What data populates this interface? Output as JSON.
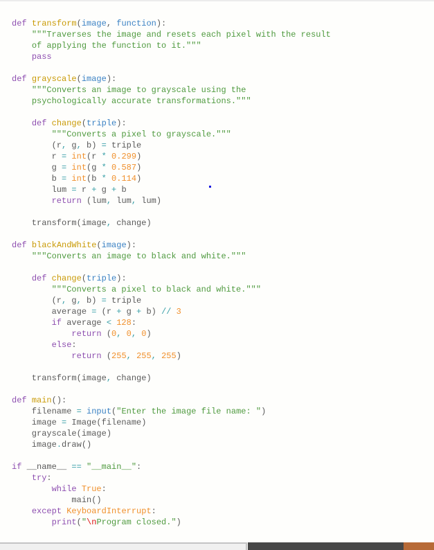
{
  "editor": {
    "language": "python",
    "lines": [
      [
        {
          "t": "def",
          "c": "kw"
        },
        {
          "t": " "
        },
        {
          "t": "transform",
          "c": "fn"
        },
        {
          "t": "("
        },
        {
          "t": "image",
          "c": "param"
        },
        {
          "t": ", "
        },
        {
          "t": "function",
          "c": "param"
        },
        {
          "t": "):"
        }
      ],
      [
        {
          "t": "    "
        },
        {
          "t": "\"\"\"Traverses the image and resets each pixel with the result",
          "c": "str"
        }
      ],
      [
        {
          "t": "    "
        },
        {
          "t": "of applying the function to it.\"\"\"",
          "c": "str"
        }
      ],
      [
        {
          "t": "    "
        },
        {
          "t": "pass",
          "c": "kw"
        }
      ],
      [],
      [
        {
          "t": "def",
          "c": "kw"
        },
        {
          "t": " "
        },
        {
          "t": "grayscale",
          "c": "fn"
        },
        {
          "t": "("
        },
        {
          "t": "image",
          "c": "param"
        },
        {
          "t": "):"
        }
      ],
      [
        {
          "t": "    "
        },
        {
          "t": "\"\"\"Converts an image to grayscale using the",
          "c": "str"
        }
      ],
      [
        {
          "t": "    "
        },
        {
          "t": "psychologically accurate transformations.\"\"\"",
          "c": "str"
        }
      ],
      [],
      [
        {
          "t": "    "
        },
        {
          "t": "def",
          "c": "kw"
        },
        {
          "t": " "
        },
        {
          "t": "change",
          "c": "fn"
        },
        {
          "t": "("
        },
        {
          "t": "triple",
          "c": "param"
        },
        {
          "t": "):"
        }
      ],
      [
        {
          "t": "        "
        },
        {
          "t": "\"\"\"Converts a pixel to grayscale.\"\"\"",
          "c": "str"
        }
      ],
      [
        {
          "t": "        (r"
        },
        {
          "t": ",",
          "c": "op"
        },
        {
          "t": " g"
        },
        {
          "t": ",",
          "c": "op"
        },
        {
          "t": " b) "
        },
        {
          "t": "=",
          "c": "op"
        },
        {
          "t": " triple"
        }
      ],
      [
        {
          "t": "        r "
        },
        {
          "t": "=",
          "c": "op"
        },
        {
          "t": " "
        },
        {
          "t": "int",
          "c": "builtin"
        },
        {
          "t": "(r "
        },
        {
          "t": "*",
          "c": "op"
        },
        {
          "t": " "
        },
        {
          "t": "0.299",
          "c": "num"
        },
        {
          "t": ")"
        }
      ],
      [
        {
          "t": "        g "
        },
        {
          "t": "=",
          "c": "op"
        },
        {
          "t": " "
        },
        {
          "t": "int",
          "c": "builtin"
        },
        {
          "t": "(g "
        },
        {
          "t": "*",
          "c": "op"
        },
        {
          "t": " "
        },
        {
          "t": "0.587",
          "c": "num"
        },
        {
          "t": ")"
        }
      ],
      [
        {
          "t": "        b "
        },
        {
          "t": "=",
          "c": "op"
        },
        {
          "t": " "
        },
        {
          "t": "int",
          "c": "builtin"
        },
        {
          "t": "(b "
        },
        {
          "t": "*",
          "c": "op"
        },
        {
          "t": " "
        },
        {
          "t": "0.114",
          "c": "num"
        },
        {
          "t": ")"
        }
      ],
      [
        {
          "t": "        lum "
        },
        {
          "t": "=",
          "c": "op"
        },
        {
          "t": " r "
        },
        {
          "t": "+",
          "c": "op"
        },
        {
          "t": " g "
        },
        {
          "t": "+",
          "c": "op"
        },
        {
          "t": " b"
        }
      ],
      [
        {
          "t": "        "
        },
        {
          "t": "return",
          "c": "kw"
        },
        {
          "t": " (lum"
        },
        {
          "t": ",",
          "c": "op"
        },
        {
          "t": " lum"
        },
        {
          "t": ",",
          "c": "op"
        },
        {
          "t": " lum)"
        }
      ],
      [],
      [
        {
          "t": "    transform(image"
        },
        {
          "t": ",",
          "c": "op"
        },
        {
          "t": " change)"
        }
      ],
      [],
      [
        {
          "t": "def",
          "c": "kw"
        },
        {
          "t": " "
        },
        {
          "t": "blackAndWhite",
          "c": "fn"
        },
        {
          "t": "("
        },
        {
          "t": "image",
          "c": "param"
        },
        {
          "t": "):"
        }
      ],
      [
        {
          "t": "    "
        },
        {
          "t": "\"\"\"Converts an image to black and white.\"\"\"",
          "c": "str"
        }
      ],
      [],
      [
        {
          "t": "    "
        },
        {
          "t": "def",
          "c": "kw"
        },
        {
          "t": " "
        },
        {
          "t": "change",
          "c": "fn"
        },
        {
          "t": "("
        },
        {
          "t": "triple",
          "c": "param"
        },
        {
          "t": "):"
        }
      ],
      [
        {
          "t": "        "
        },
        {
          "t": "\"\"\"Converts a pixel to black and white.\"\"\"",
          "c": "str"
        }
      ],
      [
        {
          "t": "        (r"
        },
        {
          "t": ",",
          "c": "op"
        },
        {
          "t": " g"
        },
        {
          "t": ",",
          "c": "op"
        },
        {
          "t": " b) "
        },
        {
          "t": "=",
          "c": "op"
        },
        {
          "t": " triple"
        }
      ],
      [
        {
          "t": "        average "
        },
        {
          "t": "=",
          "c": "op"
        },
        {
          "t": " (r "
        },
        {
          "t": "+",
          "c": "op"
        },
        {
          "t": " g "
        },
        {
          "t": "+",
          "c": "op"
        },
        {
          "t": " b) "
        },
        {
          "t": "//",
          "c": "op"
        },
        {
          "t": " "
        },
        {
          "t": "3",
          "c": "num"
        }
      ],
      [
        {
          "t": "        "
        },
        {
          "t": "if",
          "c": "kw"
        },
        {
          "t": " average "
        },
        {
          "t": "<",
          "c": "op"
        },
        {
          "t": " "
        },
        {
          "t": "128",
          "c": "num"
        },
        {
          "t": ":"
        }
      ],
      [
        {
          "t": "            "
        },
        {
          "t": "return",
          "c": "kw"
        },
        {
          "t": " ("
        },
        {
          "t": "0",
          "c": "num"
        },
        {
          "t": ",",
          "c": "op"
        },
        {
          "t": " "
        },
        {
          "t": "0",
          "c": "num"
        },
        {
          "t": ",",
          "c": "op"
        },
        {
          "t": " "
        },
        {
          "t": "0",
          "c": "num"
        },
        {
          "t": ")"
        }
      ],
      [
        {
          "t": "        "
        },
        {
          "t": "else",
          "c": "kw"
        },
        {
          "t": ":"
        }
      ],
      [
        {
          "t": "            "
        },
        {
          "t": "return",
          "c": "kw"
        },
        {
          "t": " ("
        },
        {
          "t": "255",
          "c": "num"
        },
        {
          "t": ",",
          "c": "op"
        },
        {
          "t": " "
        },
        {
          "t": "255",
          "c": "num"
        },
        {
          "t": ",",
          "c": "op"
        },
        {
          "t": " "
        },
        {
          "t": "255",
          "c": "num"
        },
        {
          "t": ")"
        }
      ],
      [],
      [
        {
          "t": "    transform(image"
        },
        {
          "t": ",",
          "c": "op"
        },
        {
          "t": " change)"
        }
      ],
      [],
      [
        {
          "t": "def",
          "c": "kw"
        },
        {
          "t": " "
        },
        {
          "t": "main",
          "c": "fn"
        },
        {
          "t": "():"
        }
      ],
      [
        {
          "t": "    filename "
        },
        {
          "t": "=",
          "c": "op"
        },
        {
          "t": " "
        },
        {
          "t": "input",
          "c": "call"
        },
        {
          "t": "("
        },
        {
          "t": "\"Enter the image file name: \"",
          "c": "str"
        },
        {
          "t": ")"
        }
      ],
      [
        {
          "t": "    image "
        },
        {
          "t": "=",
          "c": "op"
        },
        {
          "t": " Image(filename)"
        }
      ],
      [
        {
          "t": "    grayscale(image)"
        }
      ],
      [
        {
          "t": "    image"
        },
        {
          "t": ".",
          "c": "op"
        },
        {
          "t": "draw()"
        }
      ],
      [],
      [
        {
          "t": "if",
          "c": "kw"
        },
        {
          "t": " __name__ "
        },
        {
          "t": "==",
          "c": "op"
        },
        {
          "t": " "
        },
        {
          "t": "\"__main__\"",
          "c": "str"
        },
        {
          "t": ":"
        }
      ],
      [
        {
          "t": "    "
        },
        {
          "t": "try",
          "c": "kw"
        },
        {
          "t": ":"
        }
      ],
      [
        {
          "t": "        "
        },
        {
          "t": "while",
          "c": "kw"
        },
        {
          "t": " "
        },
        {
          "t": "True",
          "c": "builtin"
        },
        {
          "t": ":"
        }
      ],
      [
        {
          "t": "            main()"
        }
      ],
      [
        {
          "t": "    "
        },
        {
          "t": "except",
          "c": "kw"
        },
        {
          "t": " "
        },
        {
          "t": "KeyboardInterrupt",
          "c": "builtin"
        },
        {
          "t": ":"
        }
      ],
      [
        {
          "t": "        "
        },
        {
          "t": "print",
          "c": "kw"
        },
        {
          "t": "("
        },
        {
          "t": "\"",
          "c": "str"
        },
        {
          "t": "\\n",
          "c": "esc"
        },
        {
          "t": "Program closed.\"",
          "c": "str"
        },
        {
          "t": ")"
        }
      ]
    ]
  },
  "colors": {
    "keyword": "#8e4fb0",
    "function_name": "#c99a06",
    "parameter": "#3b82c4",
    "string": "#4f9a3f",
    "number": "#f0902c",
    "operator": "#3aa0a8",
    "status_bar": "#474747",
    "status_accent": "#b76a37"
  }
}
